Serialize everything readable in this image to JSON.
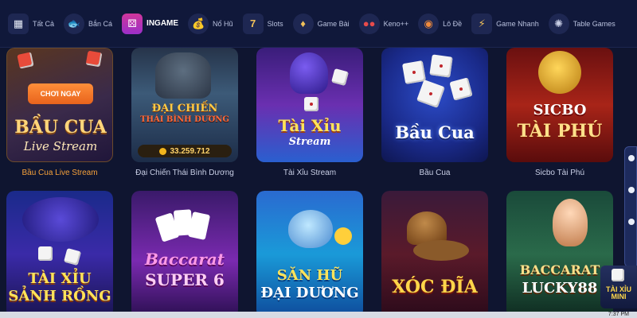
{
  "categories": [
    {
      "label": "Tất Cả",
      "icon": "grid-icon"
    },
    {
      "label": "Bắn Cá",
      "icon": "fish-icon"
    },
    {
      "label": "INGAME",
      "icon": "dice-icon"
    },
    {
      "label": "Nổ Hũ",
      "icon": "money-bag-icon"
    },
    {
      "label": "Slots",
      "icon": "slot-seven-icon"
    },
    {
      "label": "Game Bài",
      "icon": "card-icon"
    },
    {
      "label": "Keno++",
      "icon": "keno-balls-icon"
    },
    {
      "label": "Lô Đề",
      "icon": "lottery-ball-icon"
    },
    {
      "label": "Game Nhanh",
      "icon": "lightning-icon"
    },
    {
      "label": "Table Games",
      "icon": "roulette-icon"
    }
  ],
  "active_category": "INGAME",
  "games_row1": [
    {
      "title": "Bầu Cua Live Stream",
      "art_line1": "BẦU CUA",
      "art_line2": "Live Stream",
      "play_label": "CHƠI NGAY"
    },
    {
      "title": "Đại Chiến Thái Bình Dương",
      "art_line1": "ĐẠI CHIẾN",
      "art_line2": "THÁI BÌNH DƯƠNG",
      "jackpot": "33.259.712"
    },
    {
      "title": "Tài Xỉu Stream",
      "art_line1": "Tài Xỉu",
      "art_line2": "Stream"
    },
    {
      "title": "Bầu Cua",
      "art_line1": "Bầu Cua"
    },
    {
      "title": "Sicbo Tài Phú",
      "art_line1": "SICBO",
      "art_line2": "TÀI PHÚ"
    }
  ],
  "games_row2": [
    {
      "art_line1": "TÀI XỈU",
      "art_line2": "SẢNH RỒNG"
    },
    {
      "art_line1": "Baccarat",
      "art_line2": "SUPER 6"
    },
    {
      "art_line1": "SĂN HŨ",
      "art_line2": "ĐẠI DƯƠNG"
    },
    {
      "art_line1": "XÓC ĐĨA"
    },
    {
      "art_line1": "BACCARAT",
      "art_line2": "LUCKY88"
    }
  ],
  "mini_badge": {
    "line1": "TÀI XỈU",
    "line2": "MINI"
  },
  "clock": "7:37 PM",
  "colors": {
    "background": "#0f1530",
    "active_tab": "#d0379b",
    "highlight_title": "#f5a13b",
    "jackpot": "#ffd36a"
  }
}
